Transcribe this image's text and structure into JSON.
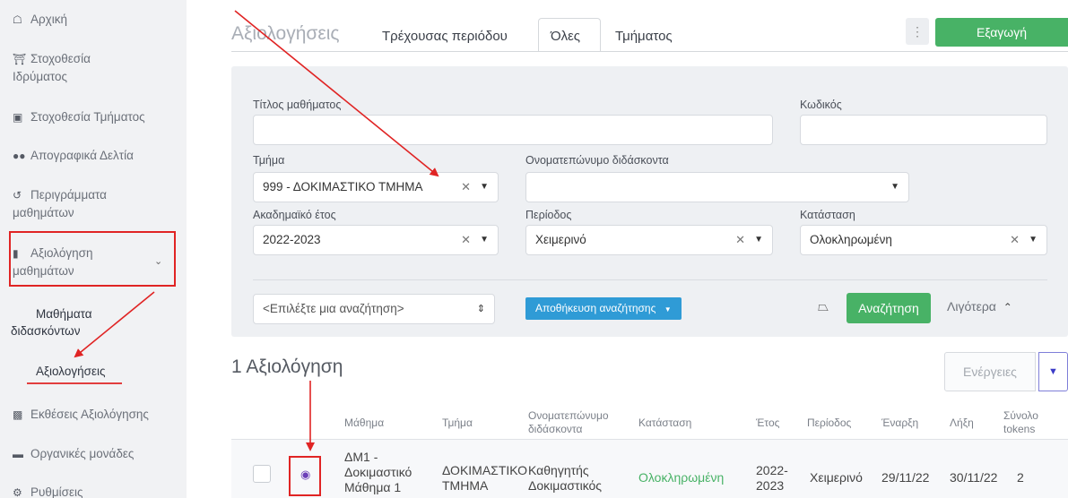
{
  "sidebar": {
    "items": [
      {
        "label": "Αρχική",
        "icon": "home-icon"
      },
      {
        "label": "Στοχοθεσία",
        "label2": "Ιδρύματος",
        "icon": "institution-icon"
      },
      {
        "label": "Στοχοθεσία Τμήματος",
        "icon": "archive-icon"
      },
      {
        "label": "Απογραφικά Δελτία",
        "icon": "users-icon"
      },
      {
        "label": "Περιγράμματα",
        "label2": "μαθημάτων",
        "icon": "history-icon"
      },
      {
        "label": "Αξιολόγηση",
        "label2": "μαθημάτων",
        "icon": "clipboard-icon"
      },
      {
        "label": "Εκθέσεις Αξιολόγησης",
        "icon": "report-icon"
      },
      {
        "label": "Οργανικές μονάδες",
        "icon": "folder-icon"
      },
      {
        "label": "Ρυθμίσεις",
        "icon": "gear-icon"
      }
    ],
    "sub_items": [
      {
        "label": "Μαθήματα",
        "label2": "διδασκόντων"
      },
      {
        "label": "Αξιολογήσεις"
      }
    ]
  },
  "header": {
    "title": "Αξιολογήσεις",
    "tabs": [
      "Τρέχουσας περιόδου",
      "Όλες",
      "Τμήματος"
    ],
    "active_tab": "Όλες",
    "export_label": "Εξαγωγή"
  },
  "filters": {
    "course_title": {
      "label": "Τίτλος μαθήματος",
      "value": ""
    },
    "code": {
      "label": "Κωδικός",
      "value": ""
    },
    "department": {
      "label": "Τμήμα",
      "value": "999 - ΔΟΚΙΜΑΣΤΙΚΟ ΤΜΗΜΑ"
    },
    "instructor": {
      "label": "Ονοματεπώνυμο διδάσκοντα",
      "value": ""
    },
    "academic_year": {
      "label": "Ακαδημαϊκό έτος",
      "value": "2022-2023"
    },
    "period": {
      "label": "Περίοδος",
      "value": "Χειμερινό"
    },
    "status": {
      "label": "Κατάσταση",
      "value": "Ολοκληρωμένη"
    },
    "saved_search_placeholder": "<Επιλέξτε μια αναζήτηση>",
    "save_search_label": "Αποθήκευση αναζήτησης",
    "search_label": "Αναζήτηση",
    "less_label": "Λιγότερα"
  },
  "results": {
    "count_label": "1 Αξιολόγηση",
    "actions_label": "Ενέργειες",
    "columns": {
      "course": "Μάθημα",
      "department": "Τμήμα",
      "instructor1": "Ονοματεπώνυμο",
      "instructor2": "διδάσκοντα",
      "status": "Κατάσταση",
      "year": "Έτος",
      "period": "Περίοδος",
      "start": "Έναρξη",
      "end": "Λήξη",
      "tokens1": "Σύνολο",
      "tokens2": "tokens"
    },
    "rows": [
      {
        "course1": "ΔΜ1 -",
        "course2": "Δοκιμαστικό",
        "course3": "Μάθημα 1",
        "department1": "ΔΟΚΙΜΑΣΤΙΚΟ",
        "department2": "ΤΜΗΜΑ",
        "instructor1": "Καθηγητής",
        "instructor2": "Δοκιμαστικός",
        "status": "Ολοκληρωμένη",
        "year1": "2022-",
        "year2": "2023",
        "period": "Χειμερινό",
        "start": "29/11/22",
        "end": "30/11/22",
        "tokens": "2"
      }
    ]
  },
  "colors": {
    "accent_green": "#48b266",
    "accent_blue": "#2f9bd6",
    "annotation_red": "#e02424",
    "status_green": "#48b266"
  }
}
